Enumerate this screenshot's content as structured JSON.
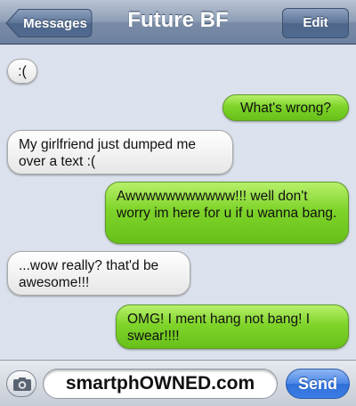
{
  "header": {
    "back_label": "Messages",
    "title": "Future BF",
    "edit_label": "Edit"
  },
  "messages": [
    {
      "sender": "contact",
      "text": ":("
    },
    {
      "sender": "me",
      "text": "What's wrong?"
    },
    {
      "sender": "contact",
      "text": "My girlfriend just dumped me over a text :("
    },
    {
      "sender": "me",
      "text": "Awwwwwwwwwww!!! well don't worry im here for u if u wanna bang."
    },
    {
      "sender": "contact",
      "text": "...wow really? that'd be awesome!!!"
    },
    {
      "sender": "me",
      "text": "OMG! I ment hang not bang! I swear!!!!"
    }
  ],
  "compose": {
    "value": "smartphOWNED.com",
    "send_label": "Send",
    "camera_icon": "camera-icon"
  },
  "colors": {
    "incoming_bubble": "#ededed",
    "outgoing_bubble": "#7fd42a",
    "background": "#dbe2ed",
    "send_button": "#3b7de6"
  }
}
